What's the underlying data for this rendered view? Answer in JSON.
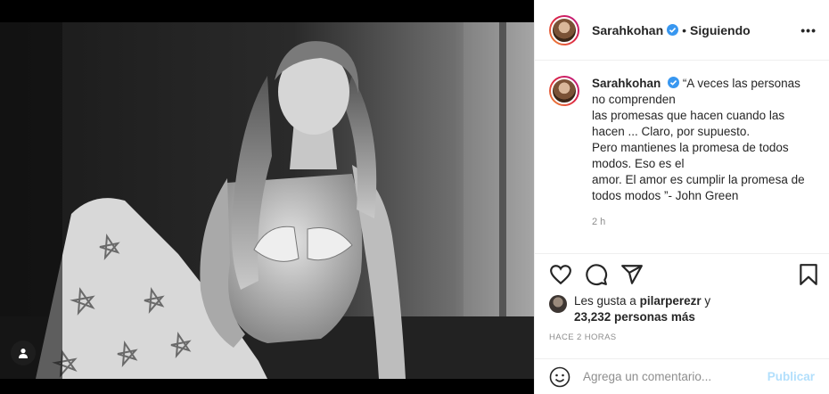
{
  "post": {
    "username": "Sarahkohan",
    "follow_status": "Siguiendo",
    "more_label": "•••",
    "separator": "•"
  },
  "caption": {
    "username": "Sarahkohan",
    "lines": [
      "“A veces las personas no comprenden",
      "las promesas que hacen cuando las hacen ... Claro, por supuesto.",
      "Pero mantienes la promesa de todos modos. Eso es el",
      "amor. El amor es cumplir la promesa de todos modos ”- John Green"
    ],
    "time": "2 h"
  },
  "actions": {
    "like_icon": "heart-icon",
    "comment_icon": "comment-icon",
    "share_icon": "share-icon",
    "save_icon": "bookmark-icon"
  },
  "likes": {
    "prefix": "Les gusta a",
    "user": "pilarperezr",
    "and": "y",
    "count": "23,232 personas más"
  },
  "posted": "HACE 2 HORAS",
  "comment_box": {
    "placeholder": "Agrega un comentario...",
    "publish_label": "Publicar",
    "emoji_icon": "smiley-icon"
  },
  "colors": {
    "verified": "#3897f0",
    "publish_disabled": "#b2dffc",
    "muted": "#8e8e8e"
  }
}
